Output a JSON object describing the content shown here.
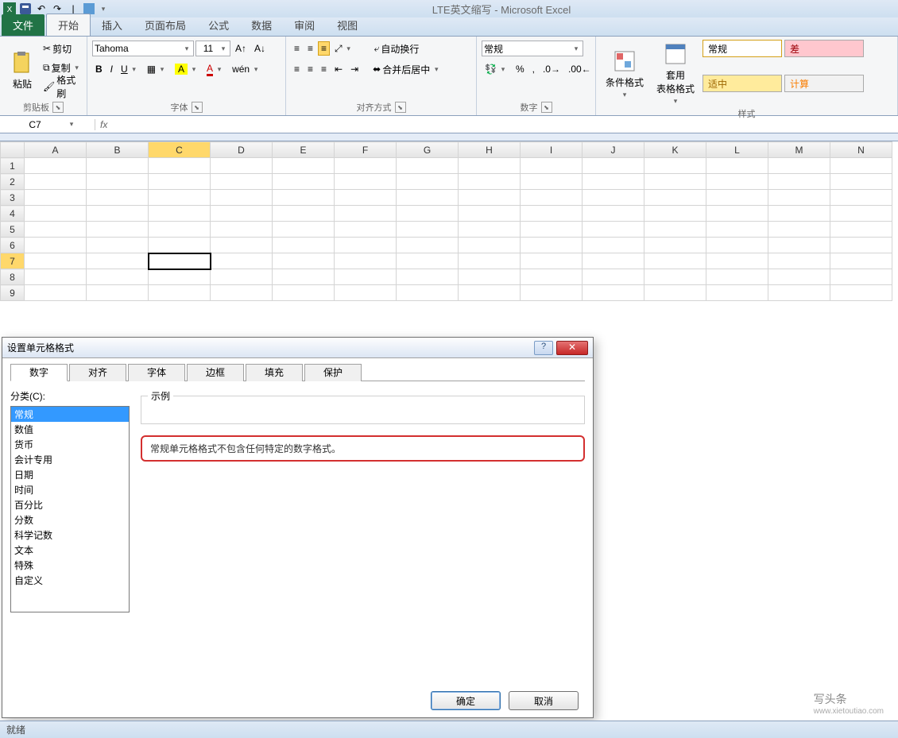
{
  "title": "LTE英文缩写 - Microsoft Excel",
  "ribbon_tabs": {
    "file": "文件",
    "home": "开始",
    "insert": "插入",
    "layout": "页面布局",
    "formulas": "公式",
    "data": "数据",
    "review": "审阅",
    "view": "视图"
  },
  "clipboard": {
    "paste": "粘贴",
    "cut": "剪切",
    "copy": "复制",
    "fmt": "格式刷",
    "label": "剪贴板"
  },
  "font": {
    "family": "Tahoma",
    "size": "11",
    "label": "字体"
  },
  "align": {
    "wrap": "自动换行",
    "merge": "合并后居中",
    "label": "对齐方式"
  },
  "number": {
    "format": "常规",
    "label": "数字"
  },
  "styles": {
    "cond": "条件格式",
    "tbl": "套用\n表格格式",
    "normal": "常规",
    "bad": "差",
    "neutral": "适中",
    "calc": "计算",
    "label": "样式"
  },
  "namebox": "C7",
  "columns": [
    "A",
    "B",
    "C",
    "D",
    "E",
    "F",
    "G",
    "H",
    "I",
    "J",
    "K",
    "L",
    "M",
    "N"
  ],
  "rows": [
    "1",
    "2",
    "3",
    "4",
    "5",
    "6",
    "7",
    "8",
    "9"
  ],
  "sel_row": 7,
  "sel_col": "C",
  "dialog": {
    "title": "设置单元格格式",
    "tabs": [
      "数字",
      "对齐",
      "字体",
      "边框",
      "填充",
      "保护"
    ],
    "cat_label": "分类(C):",
    "categories": [
      "常规",
      "数值",
      "货币",
      "会计专用",
      "日期",
      "时间",
      "百分比",
      "分数",
      "科学记数",
      "文本",
      "特殊",
      "自定义"
    ],
    "sel_cat": "常规",
    "sample_label": "示例",
    "desc": "常规单元格格式不包含任何特定的数字格式。",
    "ok": "确定",
    "cancel": "取消"
  },
  "status": "就绪",
  "watermark": {
    "brand": "写头条",
    "url": "www.xietoutiao.com"
  }
}
